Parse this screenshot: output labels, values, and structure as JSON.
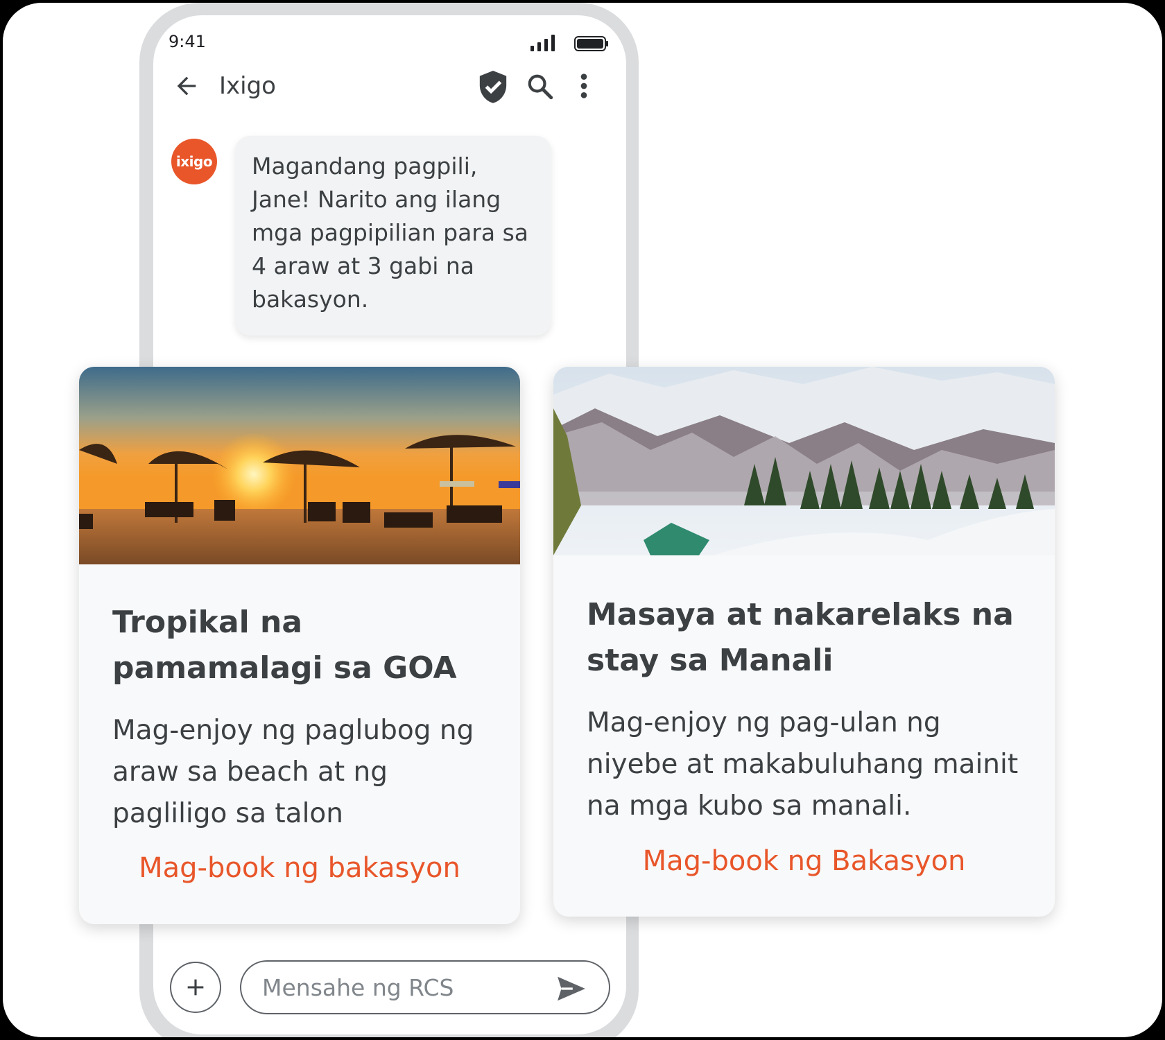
{
  "status": {
    "time": "9:41"
  },
  "appbar": {
    "title": "Ixigo"
  },
  "sender": {
    "avatar_text": "ixigo",
    "brand_color": "#e8562a"
  },
  "message": {
    "lines": [
      "Magandang pagpili,",
      "Jane! Narito ang ilang",
      "mga pagpipilian para sa",
      "4 araw at 3 gabi na",
      "bakasyon."
    ]
  },
  "cards": [
    {
      "title_lines": [
        "Tropikal na",
        "pamamalagi sa GOA"
      ],
      "desc_lines": [
        "Mag-enjoy ng paglubog ng",
        "araw sa beach at ng",
        "pagliligo sa talon"
      ],
      "action": "Mag-book ng bakasyon"
    },
    {
      "title_lines": [
        "Masaya at nakarelaks na",
        "stay sa Manali"
      ],
      "desc_lines": [
        "Mag-enjoy ng pag-ulan ng",
        "niyebe at makabuluhang mainit",
        "na mga kubo sa manali."
      ],
      "action": "Mag-book ng Bakasyon"
    }
  ],
  "composer": {
    "placeholder": "Mensahe ng RCS"
  },
  "icons": {
    "back": "back-arrow-icon",
    "verified": "verified-shield-icon",
    "search": "search-icon",
    "more": "more-vert-icon",
    "add": "plus-icon",
    "send": "send-icon"
  }
}
